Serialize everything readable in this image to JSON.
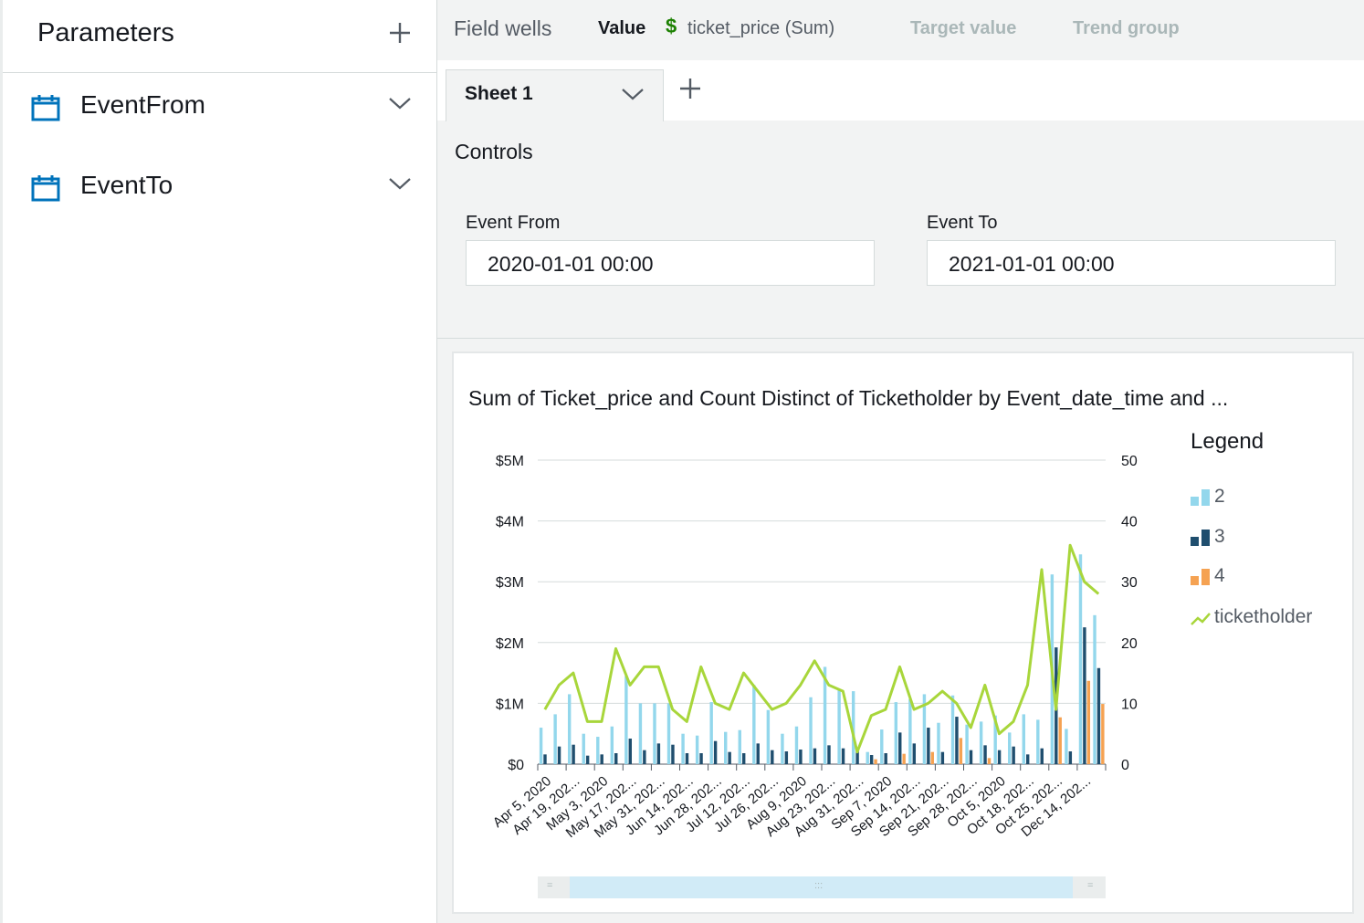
{
  "parameters": {
    "title": "Parameters",
    "add_icon": "plus-icon",
    "items": [
      {
        "name": "EventFrom",
        "icon": "calendar-icon"
      },
      {
        "name": "EventTo",
        "icon": "calendar-icon"
      }
    ]
  },
  "field_wells": {
    "label": "Field wells",
    "value_label": "Value",
    "value_field": "ticket_price (Sum)",
    "value_icon": "$",
    "target_label": "Target value",
    "trend_label": "Trend group"
  },
  "sheet_tab": {
    "label": "Sheet 1"
  },
  "controls": {
    "title": "Controls",
    "event_from": {
      "label": "Event From",
      "value": "2020-01-01 00:00"
    },
    "event_to": {
      "label": "Event To",
      "value": "2021-01-01 00:00"
    }
  },
  "legend": {
    "title": "Legend",
    "items": [
      "2",
      "3",
      "4",
      "ticketholder"
    ]
  },
  "colors": {
    "series2": "#93d7ec",
    "series3": "#1f4e6e",
    "series4": "#f5a252",
    "ticketholder": "#a8d63b",
    "accent_green": "#1d8102",
    "calendar": "#0073bb"
  },
  "chart_data": {
    "type": "bar",
    "title": "Sum of Ticket_price and Count Distinct of Ticketholder by Event_date_time and ...",
    "y_left_ticks": [
      "$0",
      "$1M",
      "$2M",
      "$3M",
      "$4M",
      "$5M"
    ],
    "y_right_ticks": [
      "0",
      "10",
      "20",
      "30",
      "40",
      "50"
    ],
    "ylim": [
      0,
      5000000
    ],
    "y2lim": [
      0,
      50
    ],
    "x_tick_labels": [
      "Apr 5, 2020",
      "Apr 19, 202...",
      "May 3, 2020",
      "May 17, 202...",
      "May 31, 202...",
      "Jun 14, 202...",
      "Jun 28, 202...",
      "Jul 12, 202...",
      "Jul 26, 202...",
      "Aug 9, 2020",
      "Aug 23, 202...",
      "Aug 31, 202...",
      "Sep 7, 2020",
      "Sep 14, 202...",
      "Sep 21, 202...",
      "Sep 28, 202...",
      "Oct 5, 2020",
      "Oct 18, 202...",
      "Oct 25, 202...",
      "Dec 14, 202..."
    ],
    "series": [
      {
        "name": "2",
        "type": "bar",
        "values": [
          600000,
          820000,
          1150000,
          500000,
          450000,
          620000,
          1450000,
          1000000,
          1000000,
          1000000,
          500000,
          470000,
          1020000,
          530000,
          560000,
          1300000,
          890000,
          500000,
          620000,
          1100000,
          1600000,
          1230000,
          1200000,
          200000,
          570000,
          1020000,
          1070000,
          1150000,
          680000,
          1130000,
          650000,
          700000,
          800000,
          520000,
          820000,
          730000,
          3120000,
          580000,
          3450000,
          2450000
        ]
      },
      {
        "name": "3",
        "type": "bar",
        "values": [
          160000,
          290000,
          320000,
          140000,
          160000,
          180000,
          420000,
          230000,
          340000,
          320000,
          180000,
          180000,
          380000,
          200000,
          180000,
          340000,
          230000,
          210000,
          240000,
          260000,
          310000,
          260000,
          260000,
          150000,
          180000,
          520000,
          340000,
          600000,
          200000,
          780000,
          230000,
          310000,
          230000,
          290000,
          160000,
          260000,
          1920000,
          210000,
          2250000,
          1580000
        ]
      },
      {
        "name": "4",
        "type": "bar",
        "values": [
          0,
          0,
          0,
          0,
          0,
          0,
          0,
          0,
          0,
          0,
          0,
          0,
          0,
          0,
          0,
          0,
          0,
          0,
          0,
          0,
          0,
          0,
          0,
          80000,
          0,
          170000,
          0,
          200000,
          0,
          430000,
          0,
          100000,
          0,
          0,
          0,
          0,
          770000,
          0,
          1370000,
          990000
        ]
      },
      {
        "name": "ticketholder",
        "type": "line",
        "values": [
          9,
          13,
          15,
          7,
          7,
          19,
          13,
          16,
          16,
          9,
          7,
          16,
          10,
          9,
          15,
          12,
          9,
          10,
          13,
          17,
          13,
          12,
          2,
          8,
          9,
          16,
          9,
          10,
          12,
          10,
          6,
          13,
          5,
          7,
          13,
          32,
          9,
          36,
          30,
          28
        ]
      }
    ]
  }
}
